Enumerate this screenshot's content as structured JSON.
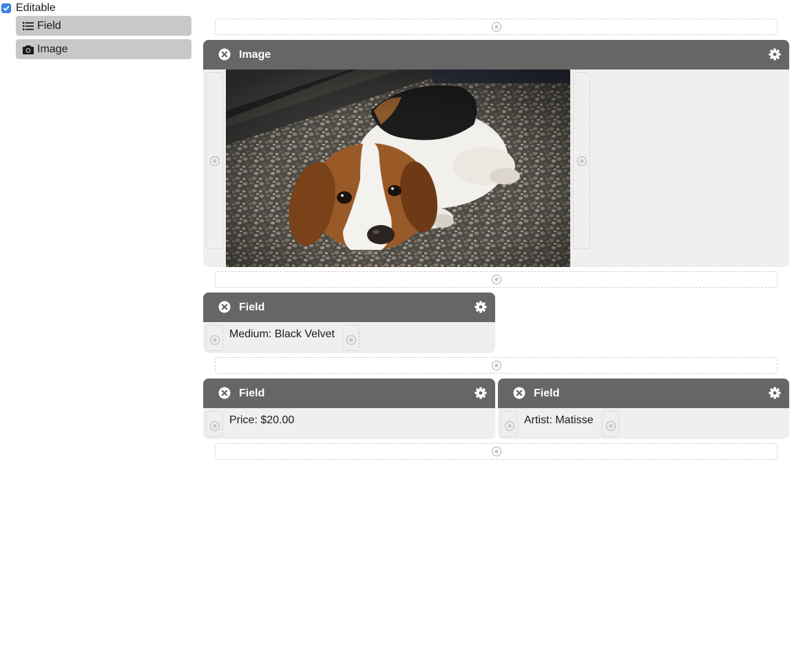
{
  "palette": {
    "editable_label": "Editable",
    "editable_checked": true,
    "items": [
      {
        "label": "Field",
        "icon": "list-icon"
      },
      {
        "label": "Image",
        "icon": "camera-icon"
      }
    ]
  },
  "canvas": {
    "image_panel": {
      "title": "Image",
      "image_alt": "Beagle puppy lying on gravel"
    },
    "row1": [
      {
        "title": "Field",
        "text": "Medium: Black Velvet"
      }
    ],
    "row2": [
      {
        "title": "Field",
        "text": "Price: $20.00"
      },
      {
        "title": "Field",
        "text": "Artist: Matisse"
      }
    ]
  },
  "colors": {
    "header_bg": "#666666",
    "panel_bg": "#efefef",
    "button_bg": "#c8c8c8",
    "checkbox": "#3b86e8"
  }
}
